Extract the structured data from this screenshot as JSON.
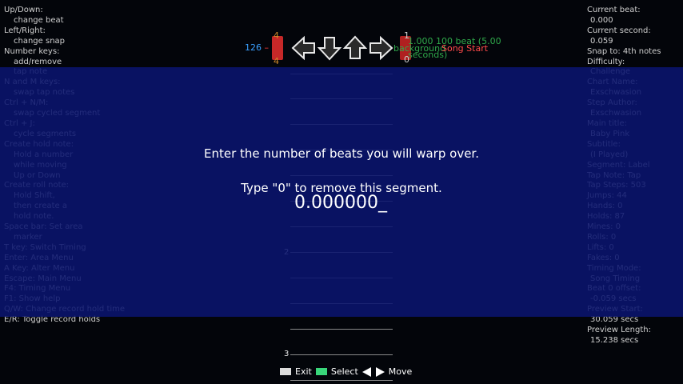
{
  "help": [
    {
      "text": "Up/Down:",
      "indent": false
    },
    {
      "text": "change beat",
      "indent": true
    },
    {
      "text": "Left/Right:",
      "indent": false
    },
    {
      "text": "change snap",
      "indent": true
    },
    {
      "text": "Number keys:",
      "indent": false
    },
    {
      "text": "add/remove",
      "indent": true
    },
    {
      "text": "tap note",
      "indent": true
    },
    {
      "text": "N and M keys:",
      "indent": false
    },
    {
      "text": "swap tap notes",
      "indent": true
    },
    {
      "text": "Ctrl + N/M:",
      "indent": false
    },
    {
      "text": "swap cycled segment",
      "indent": true
    },
    {
      "text": "Ctrl + J:",
      "indent": false
    },
    {
      "text": "cycle segments",
      "indent": true
    },
    {
      "text": "Create hold note:",
      "indent": false
    },
    {
      "text": "Hold a number",
      "indent": true
    },
    {
      "text": "while moving",
      "indent": true
    },
    {
      "text": "Up or Down",
      "indent": true
    },
    {
      "text": "Create roll note:",
      "indent": false
    },
    {
      "text": "Hold Shift,",
      "indent": true
    },
    {
      "text": "then create a",
      "indent": true
    },
    {
      "text": "hold note.",
      "indent": true
    },
    {
      "text": "Space bar: Set area",
      "indent": false
    },
    {
      "text": "marker",
      "indent": true
    },
    {
      "text": "T key: Switch Timing",
      "indent": false
    },
    {
      "text": "Enter: Area Menu",
      "indent": false
    },
    {
      "text": "A Key: Alter Menu",
      "indent": false
    },
    {
      "text": "Escape: Main Menu",
      "indent": false
    },
    {
      "text": "F4: Timing Menu",
      "indent": false
    },
    {
      "text": "F1: Show help",
      "indent": false
    },
    {
      "text": "Q/W: Change record hold time",
      "indent": false
    },
    {
      "text": "E/R: Toggle record holds",
      "indent": false
    }
  ],
  "info": [
    {
      "text": "Current beat:",
      "indent": false
    },
    {
      "text": "0.000",
      "indent": true
    },
    {
      "text": "Current second:",
      "indent": false
    },
    {
      "text": "0.059",
      "indent": true
    },
    {
      "text": "Snap to: 4th notes",
      "indent": false
    },
    {
      "text": "Difficulty:",
      "indent": false
    },
    {
      "text": "Challenge",
      "indent": true
    },
    {
      "text": "Chart Name:",
      "indent": false
    },
    {
      "text": "Exschwasion",
      "indent": true
    },
    {
      "text": "Step Author:",
      "indent": false
    },
    {
      "text": "Exschwasion",
      "indent": true
    },
    {
      "text": "Main title:",
      "indent": false
    },
    {
      "text": "Baby Pink",
      "indent": true
    },
    {
      "text": "Subtitle:",
      "indent": false
    },
    {
      "text": "(I Played)",
      "indent": true
    },
    {
      "text": "Segment: Label",
      "indent": false
    },
    {
      "text": "Tap Note: Tap",
      "indent": false
    },
    {
      "text": "Tap Steps: 503",
      "indent": false
    },
    {
      "text": "Jumps: 44",
      "indent": false
    },
    {
      "text": "Hands: 0",
      "indent": false
    },
    {
      "text": "Holds: 87",
      "indent": false
    },
    {
      "text": "Mines: 0",
      "indent": false
    },
    {
      "text": "Rolls: 0",
      "indent": false
    },
    {
      "text": "Lifts: 0",
      "indent": false
    },
    {
      "text": "Fakes: 0",
      "indent": false
    },
    {
      "text": "Timing Mode:",
      "indent": false
    },
    {
      "text": "Song Timing",
      "indent": true
    },
    {
      "text": "Beat 0 offset:",
      "indent": false
    },
    {
      "text": "-0.059 secs",
      "indent": true
    },
    {
      "text": "Preview Start:",
      "indent": false
    },
    {
      "text": "30.059 secs",
      "indent": true
    },
    {
      "text": "Preview Length:",
      "indent": false
    },
    {
      "text": "15.238 secs",
      "indent": true
    }
  ],
  "timing": {
    "bpm_left": "126",
    "bpm_left_red": "–",
    "stop_top": "4",
    "stop_bottom": "4",
    "sig_top": "1",
    "sig_bottom": "0",
    "tempo_text": "1.000 100 beat (5.00",
    "bg_text": "background",
    "song_start": "Song Start",
    "seconds_text": "seconds)"
  },
  "beat_labels": [
    "2",
    "3"
  ],
  "dialog": {
    "line1": "Enter the number of beats you will warp over.",
    "line2": "Type \"0\" to remove this segment.",
    "value": "0.000000_"
  },
  "footer": {
    "exit": "Exit",
    "select": "Select",
    "move": "Move"
  },
  "colors": {
    "overlay": "#0a146e",
    "select_key": "#39d67a",
    "bpm": "#3aa0ff",
    "tempo": "#2fa84a",
    "song_start": "#ff4a4a"
  }
}
